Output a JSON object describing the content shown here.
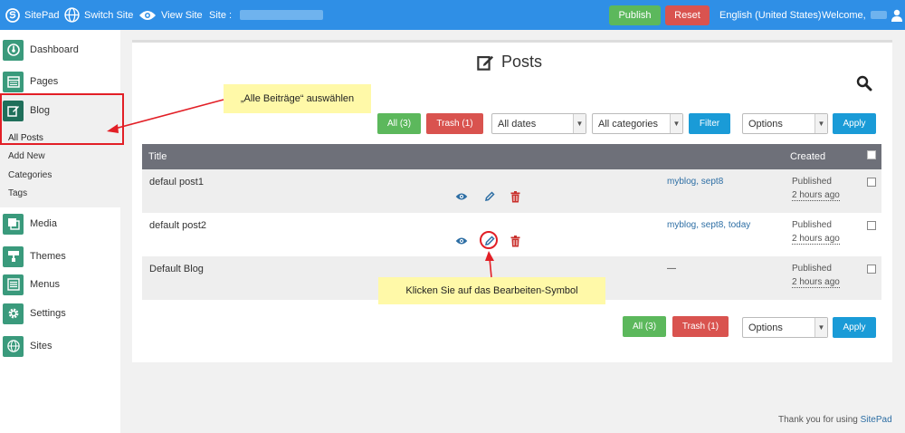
{
  "topbar": {
    "brand": "SitePad",
    "switch_site": "Switch Site",
    "view_site": "View Site",
    "site_label": "Site :",
    "publish": "Publish",
    "reset": "Reset",
    "language": "English (United States)",
    "welcome": "Welcome,"
  },
  "sidebar": {
    "items": [
      {
        "label": "Dashboard",
        "icon": "dashboard-icon"
      },
      {
        "label": "Pages",
        "icon": "pages-icon"
      },
      {
        "label": "Blog",
        "icon": "edit-icon"
      },
      {
        "label": "Media",
        "icon": "media-icon"
      },
      {
        "label": "Themes",
        "icon": "themes-icon"
      },
      {
        "label": "Menus",
        "icon": "menus-icon"
      },
      {
        "label": "Settings",
        "icon": "gear-icon"
      },
      {
        "label": "Sites",
        "icon": "globe-icon"
      }
    ],
    "blog_sub": [
      "All Posts",
      "Add New",
      "Categories",
      "Tags"
    ]
  },
  "page": {
    "title": "Posts"
  },
  "filters": {
    "all": "All (3)",
    "trash": "Trash (1)",
    "dates": "All dates",
    "categories": "All categories",
    "filter": "Filter",
    "options": "Options",
    "apply": "Apply"
  },
  "table": {
    "col_title": "Title",
    "col_created": "Created",
    "rows": [
      {
        "title": "defaul post1",
        "tags": "myblog, sept8",
        "status": "Published",
        "ago": "2 hours ago"
      },
      {
        "title": "default post2",
        "tags": "myblog, sept8, today",
        "status": "Published",
        "ago": "2 hours ago"
      },
      {
        "title": "Default Blog",
        "tags": "—",
        "status": "Published",
        "ago": "2 hours ago"
      }
    ]
  },
  "bottom": {
    "all": "All (3)",
    "trash": "Trash (1)",
    "options": "Options",
    "apply": "Apply"
  },
  "footer": {
    "text": "Thank you for using",
    "link": "SitePad"
  },
  "annotations": {
    "callout1": "„Alle Beiträge“ auswählen",
    "callout2": "Klicken Sie auf das Bearbeiten-Symbol"
  },
  "colors": {
    "topbar": "#2f8fe6",
    "sidebar_icon": "#3a9a7c",
    "green": "#5cb85c",
    "red": "#d9534f",
    "blue_btn": "#1a9bd7",
    "annotation_red": "#e21f26",
    "callout_yellow": "#fff9a8"
  }
}
